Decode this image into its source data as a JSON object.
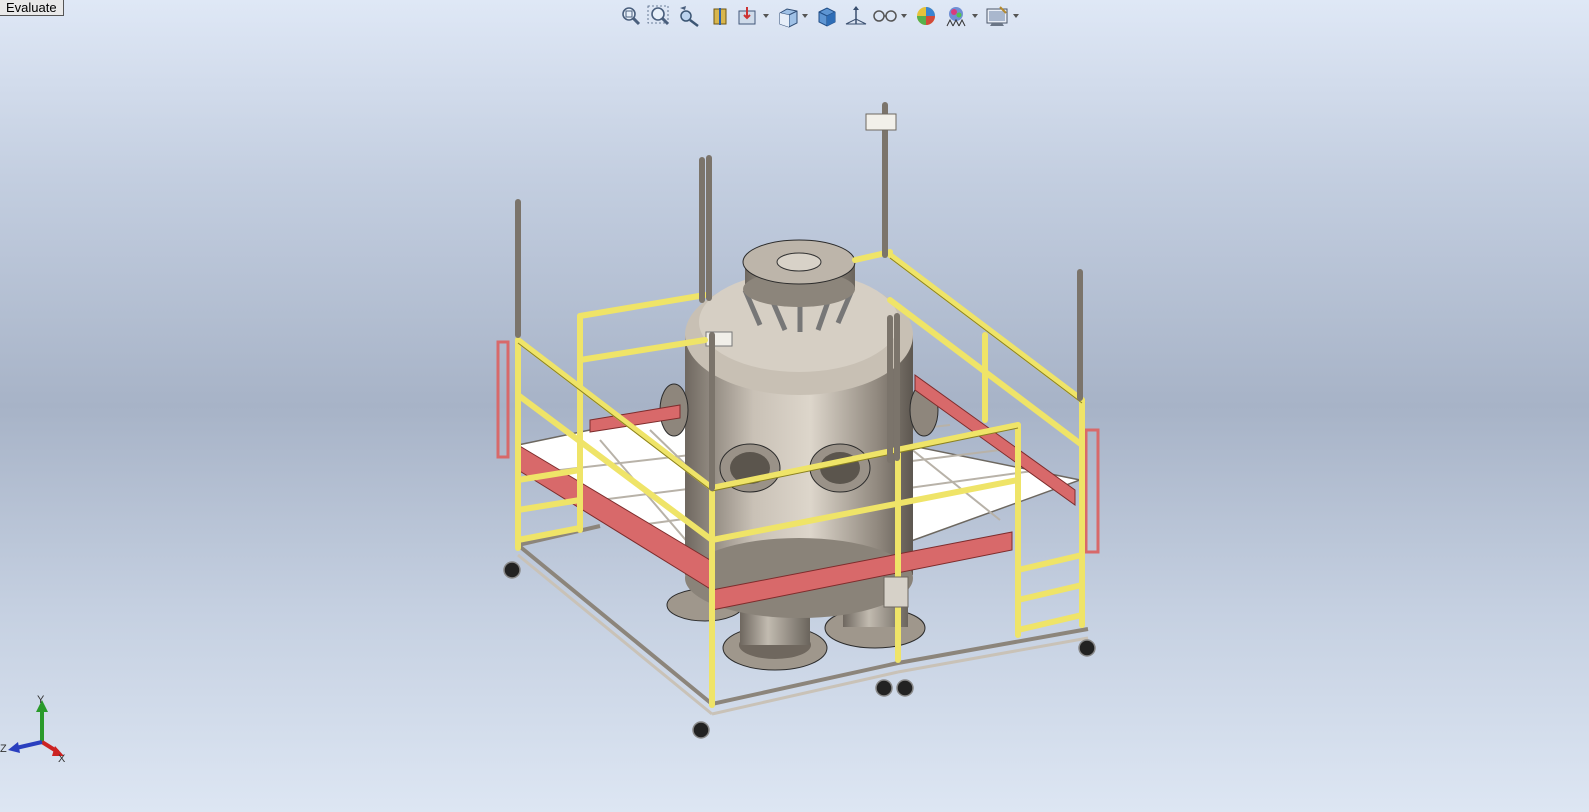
{
  "evaluate_tab": {
    "label": "Evaluate"
  },
  "heads_up_toolbar": {
    "items": [
      {
        "icon": "zoom-to-fit-icon"
      },
      {
        "icon": "zoom-to-area-icon"
      },
      {
        "icon": "previous-view-icon"
      },
      {
        "icon": "section-view-icon"
      },
      {
        "icon": "dynamic-annotation-icon",
        "dropdown": true
      },
      {
        "icon": "view-orientation-icon",
        "dropdown": true
      },
      {
        "icon": "display-style-icon"
      },
      {
        "icon": "hide-show-items-icon"
      },
      {
        "icon": "edit-appearance-icon",
        "dropdown": true
      },
      {
        "icon": "apply-scene-icon"
      },
      {
        "icon": "view-settings-icon",
        "dropdown": true
      },
      {
        "icon": "display-pane-icon",
        "dropdown": true
      }
    ]
  },
  "triad": {
    "x": "X",
    "y": "Y",
    "z": "Z"
  },
  "colors": {
    "railing": "#efe468",
    "railing_edge": "#8a8020",
    "kick_plate": "#d8696a",
    "vessel": "#b7afa6",
    "frame": "#b9b2a8",
    "deck": "#ffffff"
  }
}
